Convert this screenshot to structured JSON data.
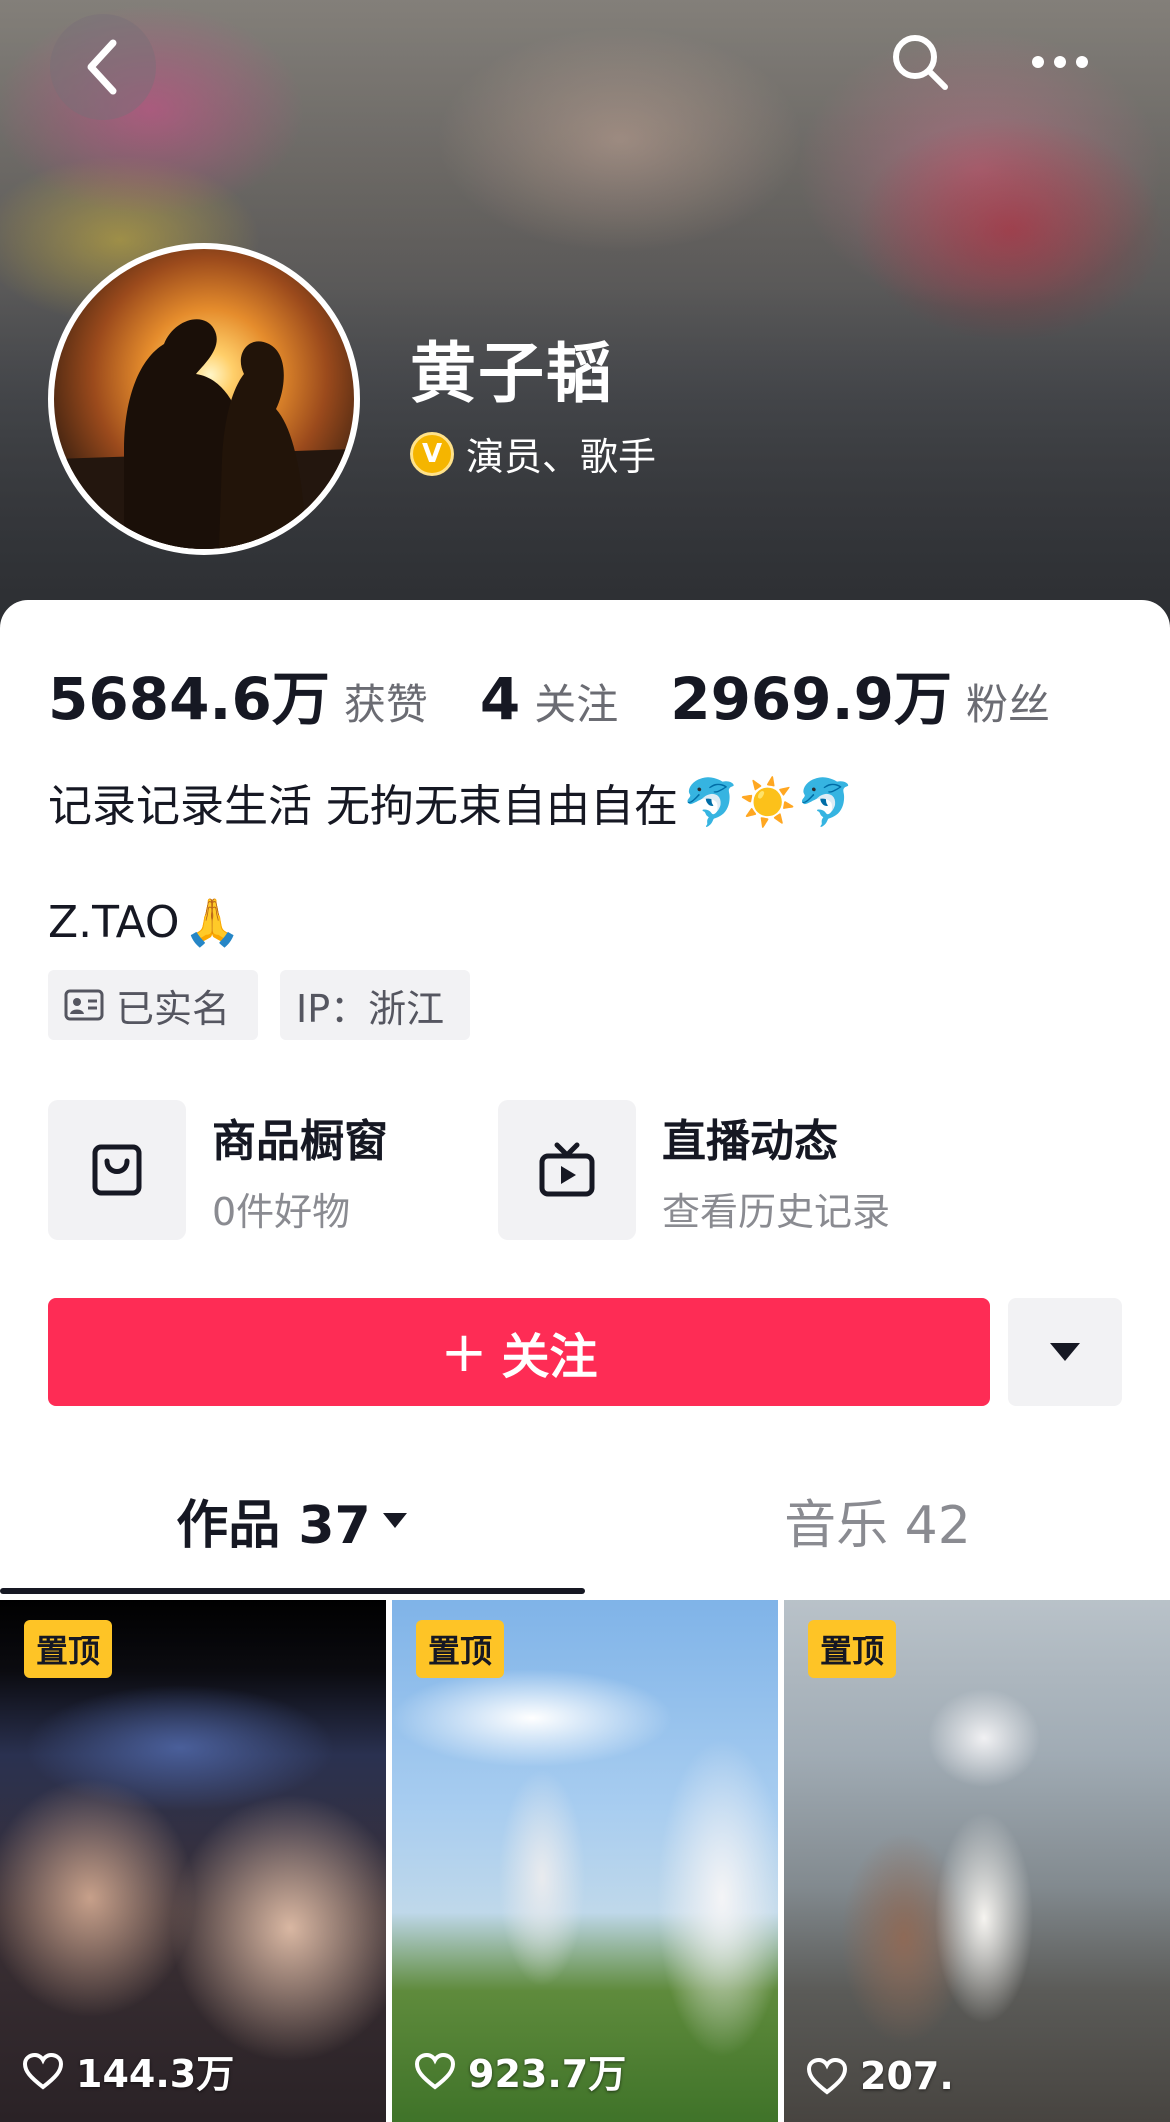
{
  "header": {
    "back_icon": "chevron-left-icon",
    "search_icon": "search-icon",
    "more_icon": "more-horizontal-icon"
  },
  "profile": {
    "name": "黄子韬",
    "verify_badge": "V",
    "verify_text": "演员、歌手"
  },
  "stats": [
    {
      "value": "5684.6万",
      "label": "获赞"
    },
    {
      "value": "4",
      "label": "关注"
    },
    {
      "value": "2969.9万",
      "label": "粉丝"
    }
  ],
  "bio": {
    "text": "记录记录生活 无拘无束自由自在",
    "emojis": "🐬☀️🐬",
    "signature": "Z.TAO",
    "signature_emoji": "🙏"
  },
  "tags": {
    "realname": "已实名",
    "ip": "IP：浙江"
  },
  "services": [
    {
      "title": "商品橱窗",
      "subtitle": "0件好物",
      "icon": "shopping-bag-icon"
    },
    {
      "title": "直播动态",
      "subtitle": "查看历史记录",
      "icon": "tv-icon"
    }
  ],
  "actions": {
    "follow_plus": "+",
    "follow_label": "关注",
    "dropdown_icon": "caret-down-icon"
  },
  "tabs": [
    {
      "label": "作品 37",
      "active": true
    },
    {
      "label": "音乐 42",
      "active": false
    }
  ],
  "videos": [
    {
      "pin": "置顶",
      "likes": "144.3万"
    },
    {
      "pin": "置顶",
      "likes": "923.7万"
    },
    {
      "pin": "置顶",
      "likes": "207."
    }
  ],
  "colors": {
    "accent": "#fe2c55",
    "pin": "#fec426",
    "verify": "#f5b500"
  }
}
